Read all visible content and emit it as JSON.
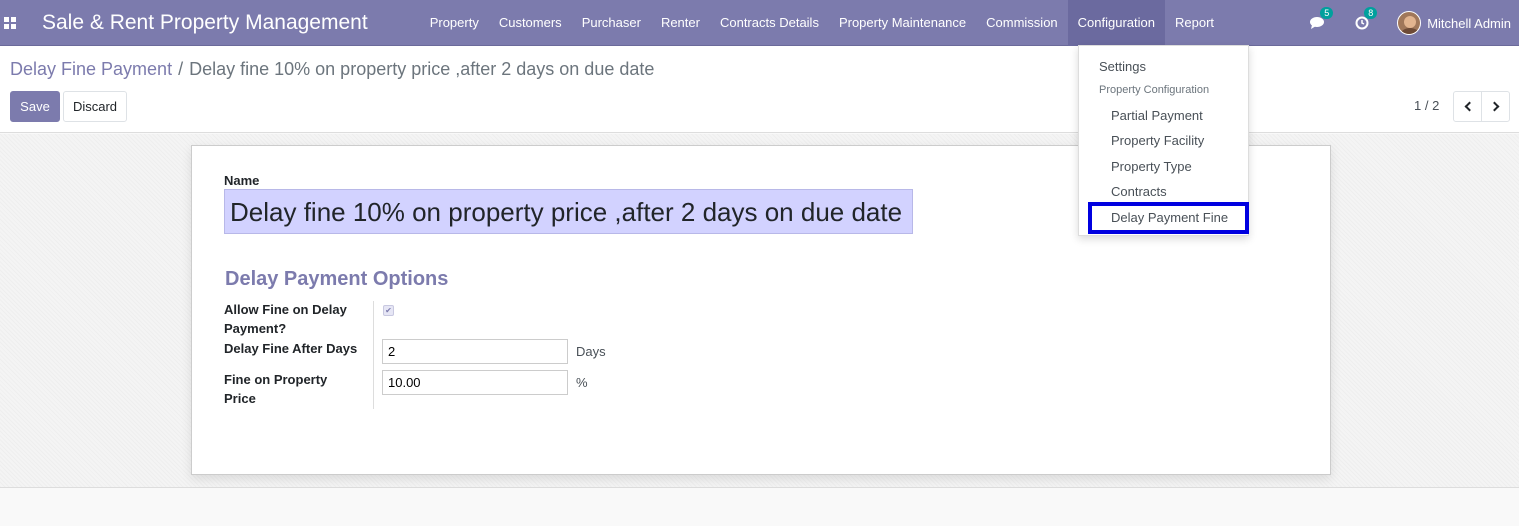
{
  "navbar": {
    "brand": "Sale & Rent Property Management",
    "menu": [
      {
        "label": "Property",
        "active": false
      },
      {
        "label": "Customers",
        "active": false
      },
      {
        "label": "Purchaser",
        "active": false
      },
      {
        "label": "Renter",
        "active": false
      },
      {
        "label": "Contracts Details",
        "active": false
      },
      {
        "label": "Property Maintenance",
        "active": false
      },
      {
        "label": "Commission",
        "active": false
      },
      {
        "label": "Configuration",
        "active": true
      },
      {
        "label": "Report",
        "active": false
      }
    ],
    "messages_count": "5",
    "activities_count": "8",
    "user_name": "Mitchell Admin"
  },
  "breadcrumb": {
    "parent": "Delay Fine Payment",
    "separator": "/",
    "current": "Delay fine 10% on property price ,after 2 days on due date"
  },
  "actions": {
    "save_label": "Save",
    "discard_label": "Discard"
  },
  "pager": {
    "value": "1 / 2"
  },
  "form": {
    "name_label": "Name",
    "name_value": "Delay fine 10% on property price ,after 2 days on due date",
    "section_title": "Delay Payment Options",
    "allow_fine_label_line1": "Allow Fine on Delay",
    "allow_fine_label_line2": "Payment?",
    "allow_fine_checked": true,
    "delay_days_label": "Delay Fine After Days",
    "delay_days_value": "2",
    "delay_days_unit": "Days",
    "fine_label_line1": "Fine on Property",
    "fine_label_line2": "Price",
    "fine_value": "10.00",
    "fine_unit": "%"
  },
  "config_menu": {
    "settings": "Settings",
    "header": "Property Configuration",
    "items": [
      "Partial Payment",
      "Property Facility",
      "Property Type",
      "Contracts",
      "Delay Payment Fine"
    ],
    "highlighted_item": "Delay Payment Fine"
  },
  "colors": {
    "primary": "#7c7bad",
    "highlight_border": "#0000e0",
    "badge": "#00a09d"
  }
}
